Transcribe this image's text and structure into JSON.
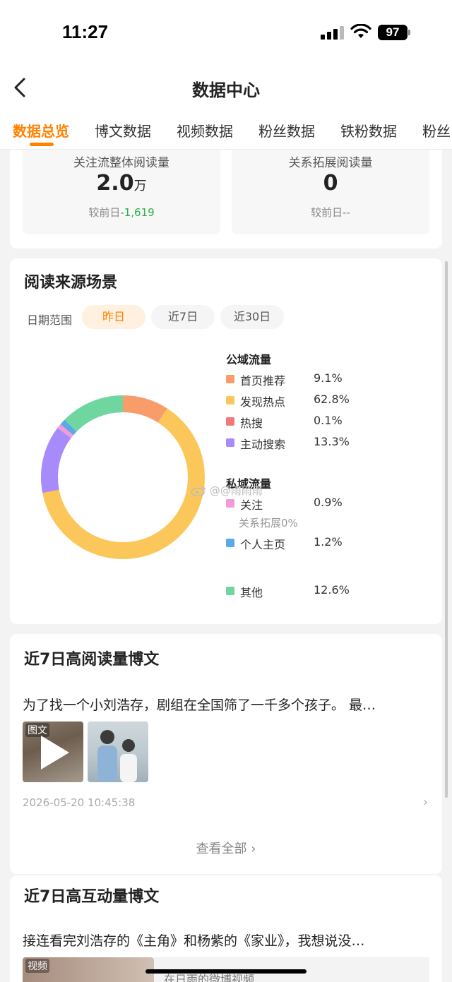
{
  "status": {
    "time": "11:27",
    "battery": "97"
  },
  "header": {
    "title": "数据中心"
  },
  "tabs": [
    "数据总览",
    "博文数据",
    "视频数据",
    "粉丝数据",
    "铁粉数据",
    "粉丝"
  ],
  "overview": {
    "metric1": {
      "label": "关注流整体阅读量",
      "value": "2.0",
      "unit": "万",
      "compare_label": "较前日",
      "delta": "-1,619"
    },
    "metric2": {
      "label": "关系拓展阅读量",
      "value": "0",
      "compare_label": "较前日",
      "delta": "--"
    }
  },
  "reading_source": {
    "title": "阅读来源场景",
    "range_label": "日期范围",
    "ranges": [
      "昨日",
      "近7日",
      "近30日"
    ],
    "selected_range": "昨日",
    "public_group": "公域流量",
    "private_group": "私域流量",
    "sub_note": "关系拓展0%",
    "watermark": "@@雨雨雨"
  },
  "chart_data": {
    "type": "pie",
    "style": "donut",
    "legend_position": "right",
    "series": [
      {
        "name": "首页推荐",
        "value": 9.1,
        "label": "9.1%",
        "color": "#f89c6a",
        "group": "公域流量"
      },
      {
        "name": "发现热点",
        "value": 62.8,
        "label": "62.8%",
        "color": "#fcc75a",
        "group": "公域流量"
      },
      {
        "name": "热搜",
        "value": 0.1,
        "label": "0.1%",
        "color": "#f07a7a",
        "group": "公域流量"
      },
      {
        "name": "主动搜索",
        "value": 13.3,
        "label": "13.3%",
        "color": "#a78bfa",
        "group": "公域流量"
      },
      {
        "name": "关注",
        "value": 0.9,
        "label": "0.9%",
        "color": "#f49ad6",
        "group": "私域流量"
      },
      {
        "name": "个人主页",
        "value": 1.2,
        "label": "1.2%",
        "color": "#5ba9e6",
        "group": "私域流量"
      },
      {
        "name": "其他",
        "value": 12.6,
        "label": "12.6%",
        "color": "#6fd6a0",
        "group": "私域流量"
      }
    ]
  },
  "top_read": {
    "title": "近7日高阅读量博文",
    "post_text": "为了找一个小刘浩存，剧组在全国筛了一千多个孩子。 最…",
    "thumb_badge": "图文",
    "time": "2026-05-20 10:45:38",
    "view_all": "查看全部"
  },
  "top_interact": {
    "title": "近7日高互动量博文",
    "post_text": "接连看完刘浩存的《主角》和杨紫的《家业》，我想说没…",
    "thumb_badge": "视频",
    "caption": "在日雨的微博视频"
  },
  "colors": {
    "accent": "#ff8200",
    "delta_green": "#2cae4a"
  }
}
